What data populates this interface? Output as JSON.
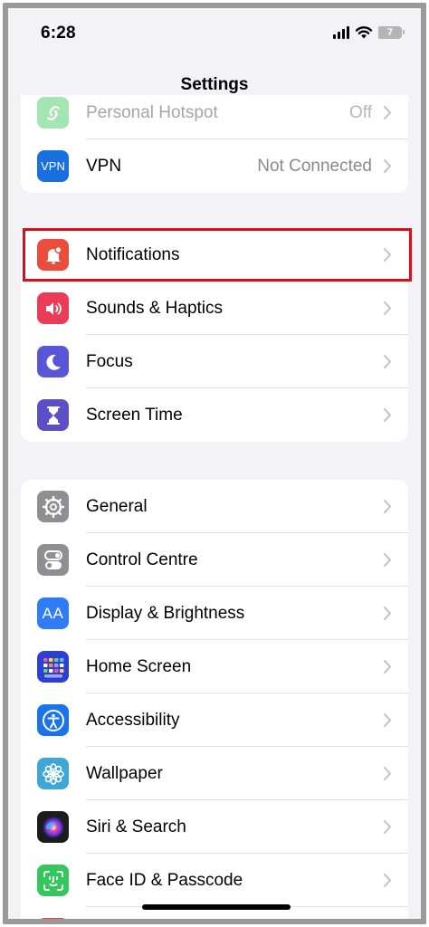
{
  "status_bar": {
    "time": "6:28",
    "battery_level": "7",
    "battery_fraction": 0.07
  },
  "nav": {
    "title": "Settings"
  },
  "groups": [
    {
      "items": [
        {
          "label": "Personal Hotspot",
          "value": "Off",
          "icon": "hotspot-icon",
          "color": "#34c759"
        },
        {
          "label": "VPN",
          "value": "Not Connected",
          "icon": "vpn-icon",
          "icon_text": "VPN",
          "color": "#1a6fe0"
        }
      ]
    },
    {
      "items": [
        {
          "label": "Notifications",
          "icon": "bell-icon",
          "color": "#eb4c3c"
        },
        {
          "label": "Sounds & Haptics",
          "icon": "speaker-icon",
          "color": "#eb3b56"
        },
        {
          "label": "Focus",
          "icon": "moon-icon",
          "color": "#5856d6"
        },
        {
          "label": "Screen Time",
          "icon": "hourglass-icon",
          "color": "#5c4ec4"
        }
      ]
    },
    {
      "items": [
        {
          "label": "General",
          "icon": "gear-icon",
          "color": "#8e8e93"
        },
        {
          "label": "Control Centre",
          "icon": "toggles-icon",
          "color": "#8e8e93"
        },
        {
          "label": "Display & Brightness",
          "icon": "text-size-icon",
          "icon_text": "AA",
          "color": "#2f7cf6"
        },
        {
          "label": "Home Screen",
          "icon": "home-grid-icon",
          "color": "#2b3fd6"
        },
        {
          "label": "Accessibility",
          "icon": "accessibility-icon",
          "color": "#1a73e8"
        },
        {
          "label": "Wallpaper",
          "icon": "flower-icon",
          "color": "#3fa7d8"
        },
        {
          "label": "Siri & Search",
          "icon": "siri-icon",
          "color": "#1c1c1e"
        },
        {
          "label": "Face ID & Passcode",
          "icon": "face-id-icon",
          "color": "#34c759"
        }
      ]
    }
  ],
  "highlight_color": "#d3101c"
}
